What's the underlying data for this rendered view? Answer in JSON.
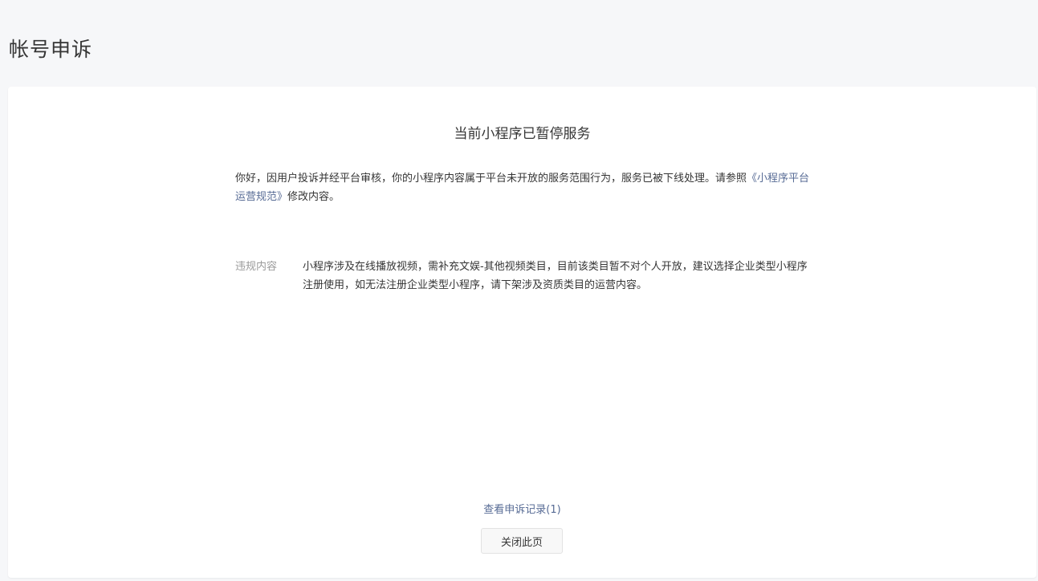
{
  "page": {
    "title": "帐号申诉"
  },
  "notice": {
    "title": "当前小程序已暂停服务",
    "body_prefix": "你好，因用户投诉并经平台审核，你的小程序内容属于平台未开放的服务范围行为，服务已被下线处理。请参照",
    "rules_link": "《小程序平台运营规范》",
    "body_suffix": "修改内容。"
  },
  "violation": {
    "label": "违规内容",
    "text": "小程序涉及在线播放视频，需补充文娱-其他视频类目，目前该类目暂不对个人开放，建议选择企业类型小程序注册使用，如无法注册企业类型小程序，请下架涉及资质类目的运营内容。"
  },
  "actions": {
    "record_link": "查看申诉记录(1)",
    "close_button": "关闭此页"
  },
  "colors": {
    "link": "#576b95",
    "background": "#f6f7f9",
    "card": "#ffffff"
  }
}
